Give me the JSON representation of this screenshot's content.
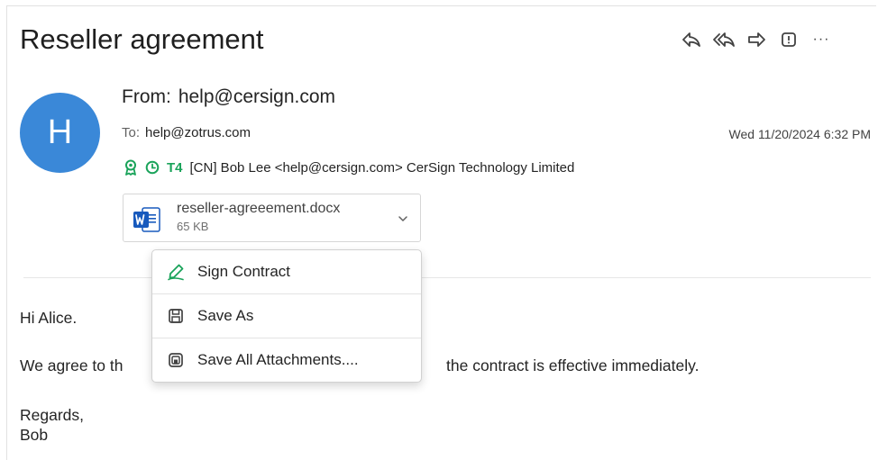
{
  "email": {
    "subject": "Reseller agreement",
    "avatar_initial": "H",
    "from_label": "From:",
    "from_address": "help@cersign.com",
    "to_label": "To:",
    "to_address": "help@zotrus.com",
    "date": "Wed 11/20/2024 6:32 PM",
    "signature_badge": "T4",
    "signature_info": "[CN] Bob Lee <help@cersign.com> CerSign Technology Limited"
  },
  "toolbar": {
    "icons": [
      "reply-icon",
      "reply-all-icon",
      "forward-icon",
      "report-icon",
      "more-icon"
    ],
    "more_label": "···"
  },
  "attachment": {
    "name": "reseller-agreeement.docx",
    "size": "65 KB"
  },
  "context_menu": {
    "items": [
      {
        "label": "Sign Contract",
        "icon": "sign-pen-icon"
      },
      {
        "label": "Save As",
        "icon": "save-icon"
      },
      {
        "label": "Save All Attachments....",
        "icon": "save-all-icon"
      }
    ]
  },
  "body": {
    "greeting": "Hi Alice.",
    "line_left": "We agree to th",
    "line_right": "the contract is effective immediately.",
    "closing": "Regards,",
    "signature_name": "Bob"
  },
  "colors": {
    "avatar": "#3a88d8",
    "signature_green": "#1aa35a",
    "word_blue": "#185abd"
  }
}
